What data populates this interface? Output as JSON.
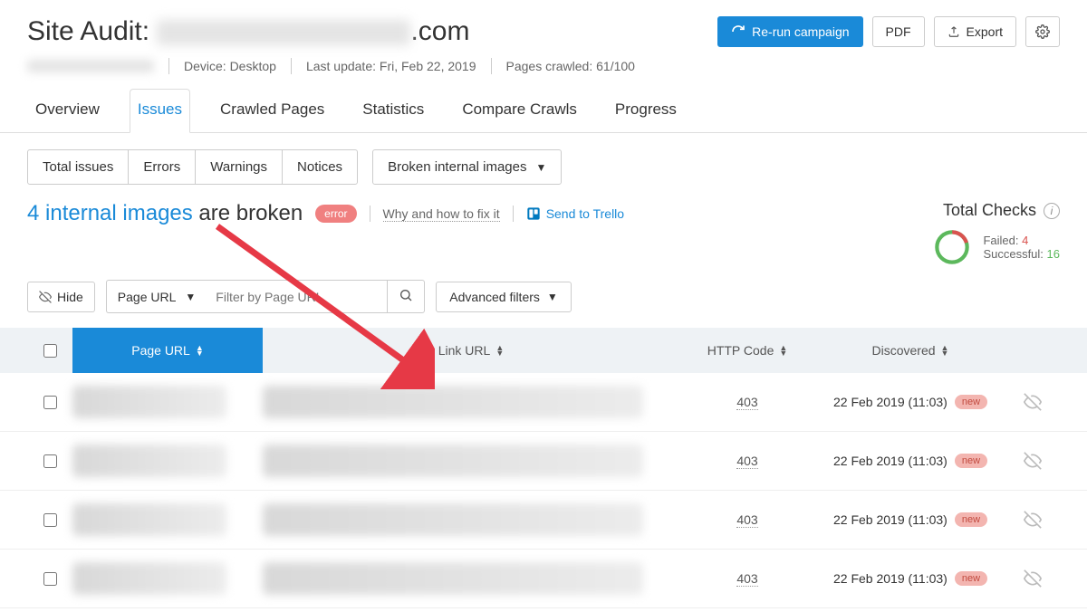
{
  "header": {
    "title_prefix": "Site Audit: ",
    "title_suffix": ".com",
    "rerun": "Re-run campaign",
    "pdf": "PDF",
    "export": "Export",
    "device": "Device: Desktop",
    "last_update": "Last update: Fri, Feb 22, 2019",
    "pages_crawled": "Pages crawled: 61/100"
  },
  "tabs": [
    "Overview",
    "Issues",
    "Crawled Pages",
    "Statistics",
    "Compare Crawls",
    "Progress"
  ],
  "active_tab": 1,
  "filters": {
    "total_issues": "Total issues",
    "errors": "Errors",
    "warnings": "Warnings",
    "notices": "Notices",
    "issue_type": "Broken internal images"
  },
  "issue": {
    "count_link": "4 internal images",
    "rest": " are broken",
    "badge": "error",
    "why": "Why and how to fix it",
    "trello": "Send to Trello"
  },
  "total_checks": {
    "title": "Total Checks",
    "failed_label": "Failed: ",
    "failed_count": "4",
    "successful_label": "Successful: ",
    "successful_count": "16"
  },
  "filter2": {
    "hide": "Hide",
    "pageurl": "Page URL",
    "placeholder": "Filter by Page URL",
    "advanced": "Advanced filters"
  },
  "table": {
    "headers": {
      "page_url": "Page URL",
      "link_url": "Link URL",
      "http_code": "HTTP Code",
      "discovered": "Discovered"
    },
    "rows": [
      {
        "http": "403",
        "discovered": "22 Feb 2019 (11:03)",
        "badge": "new"
      },
      {
        "http": "403",
        "discovered": "22 Feb 2019 (11:03)",
        "badge": "new"
      },
      {
        "http": "403",
        "discovered": "22 Feb 2019 (11:03)",
        "badge": "new"
      },
      {
        "http": "403",
        "discovered": "22 Feb 2019 (11:03)",
        "badge": "new"
      }
    ]
  },
  "chart_data": {
    "type": "pie",
    "title": "Total Checks",
    "series": [
      {
        "name": "Failed",
        "value": 4,
        "color": "#d9534f"
      },
      {
        "name": "Successful",
        "value": 16,
        "color": "#5cb85c"
      }
    ]
  }
}
